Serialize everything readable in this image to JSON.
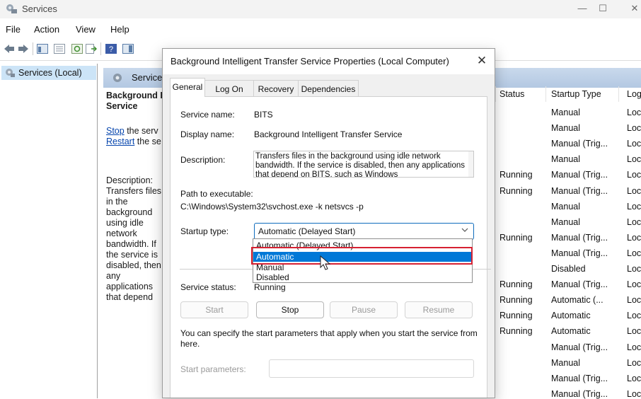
{
  "window": {
    "title": "Services",
    "minimize": "—",
    "maximize": "☐",
    "close": "✕"
  },
  "menu": [
    "File",
    "Action",
    "View",
    "Help"
  ],
  "tree": {
    "root_label": "Services (Local)"
  },
  "panel": {
    "header_label": "Service",
    "service_name_bold": "Background Intelligent Transfer Service",
    "stop_link": "Stop",
    "stop_rest": " the serv",
    "restart_link": "Restart",
    "restart_rest": " the se",
    "description_text": "Description: Transfers files in the background using idle network bandwidth. If the service is disabled, then any applications that depend on BITS, such as Windows Explorer, will be unable to automatically download programs and other information."
  },
  "columns": {
    "status": "Status",
    "startup_type": "Startup Type",
    "log_on": "Log"
  },
  "rows": [
    {
      "status": "",
      "startup": "Manual",
      "logon": "Loc"
    },
    {
      "status": "",
      "startup": "Manual",
      "logon": "Loc"
    },
    {
      "status": "",
      "startup": "Manual (Trig...",
      "logon": "Loc"
    },
    {
      "status": "",
      "startup": "Manual",
      "logon": "Loc"
    },
    {
      "status": "Running",
      "startup": "Manual (Trig...",
      "logon": "Loc"
    },
    {
      "status": "Running",
      "startup": "Manual (Trig...",
      "logon": "Loc"
    },
    {
      "status": "",
      "startup": "Manual",
      "logon": "Loc"
    },
    {
      "status": "",
      "startup": "Manual",
      "logon": "Loc"
    },
    {
      "status": "Running",
      "startup": "Manual (Trig...",
      "logon": "Loc"
    },
    {
      "status": "",
      "startup": "Manual (Trig...",
      "logon": "Loc"
    },
    {
      "status": "",
      "startup": "Disabled",
      "logon": "Loc"
    },
    {
      "status": "Running",
      "startup": "Manual (Trig...",
      "logon": "Loc"
    },
    {
      "status": "Running",
      "startup": "Automatic (...",
      "logon": "Loc"
    },
    {
      "status": "Running",
      "startup": "Automatic",
      "logon": "Loc"
    },
    {
      "status": "Running",
      "startup": "Automatic",
      "logon": "Loc"
    },
    {
      "status": "",
      "startup": "Manual (Trig...",
      "logon": "Loc"
    },
    {
      "status": "",
      "startup": "Manual",
      "logon": "Loc"
    },
    {
      "status": "",
      "startup": "Manual (Trig...",
      "logon": "Loc"
    },
    {
      "status": "",
      "startup": "Manual (Trig...",
      "logon": "Loc"
    }
  ],
  "dialog": {
    "title": "Background Intelligent Transfer Service Properties (Local Computer)",
    "close": "✕",
    "tabs": [
      "General",
      "Log On",
      "Recovery",
      "Dependencies"
    ],
    "service_name_label": "Service name:",
    "service_name_value": "BITS",
    "display_name_label": "Display name:",
    "display_name_value": "Background Intelligent Transfer Service",
    "description_label": "Description:",
    "description_value": "Transfers files in the background using idle network bandwidth. If the service is disabled, then any applications that depend on BITS, such as Windows",
    "path_label": "Path to executable:",
    "path_value": "C:\\Windows\\System32\\svchost.exe -k netsvcs -p",
    "startup_type_label": "Startup type:",
    "startup_type_value": "Automatic (Delayed Start)",
    "startup_options": [
      "Automatic (Delayed Start)",
      "Automatic",
      "Manual",
      "Disabled"
    ],
    "highlighted_option": "Automatic",
    "service_status_label": "Service status:",
    "service_status_value": "Running",
    "buttons": {
      "start": "Start",
      "stop": "Stop",
      "pause": "Pause",
      "resume": "Resume"
    },
    "hint": "You can specify the start parameters that apply when you start the service from here.",
    "start_params_label": "Start parameters:",
    "start_params_value": ""
  }
}
